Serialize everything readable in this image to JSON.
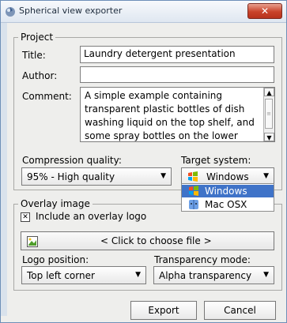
{
  "window": {
    "title": "Spherical view exporter",
    "close_label": "✕"
  },
  "project": {
    "legend": "Project",
    "title_label": "Title:",
    "title_value": "Laundry detergent presentation",
    "author_label": "Author:",
    "author_value": "",
    "comment_label": "Comment:",
    "comment_value": "A simple example containing transparent plastic bottles of dish washing liquid on the top shelf, and some spray bottles on the lower right",
    "compression_label": "Compression quality:",
    "compression_value": "95% - High quality",
    "target_label": "Target system:",
    "target_value": "Windows",
    "target_options": [
      "Windows",
      "Mac OSX"
    ]
  },
  "overlay": {
    "legend": "Overlay image",
    "include_label": "Include an overlay logo",
    "include_checked": true,
    "file_button_label": "< Click to choose file >",
    "logo_position_label": "Logo position:",
    "logo_position_value": "Top left corner",
    "transparency_label": "Transparency mode:",
    "transparency_value": "Alpha transparency"
  },
  "buttons": {
    "export": "Export",
    "cancel": "Cancel"
  },
  "icons": {
    "app": "app-icon",
    "windows": "windows-logo-icon",
    "mac": "mac-finder-icon",
    "file": "image-file-icon",
    "dropdown": "dropdown-arrow-icon",
    "scroll_up": "scroll-up-icon",
    "scroll_down": "scroll-down-icon"
  },
  "colors": {
    "selection": "#3f73c8",
    "close_button": "#c9422a"
  }
}
